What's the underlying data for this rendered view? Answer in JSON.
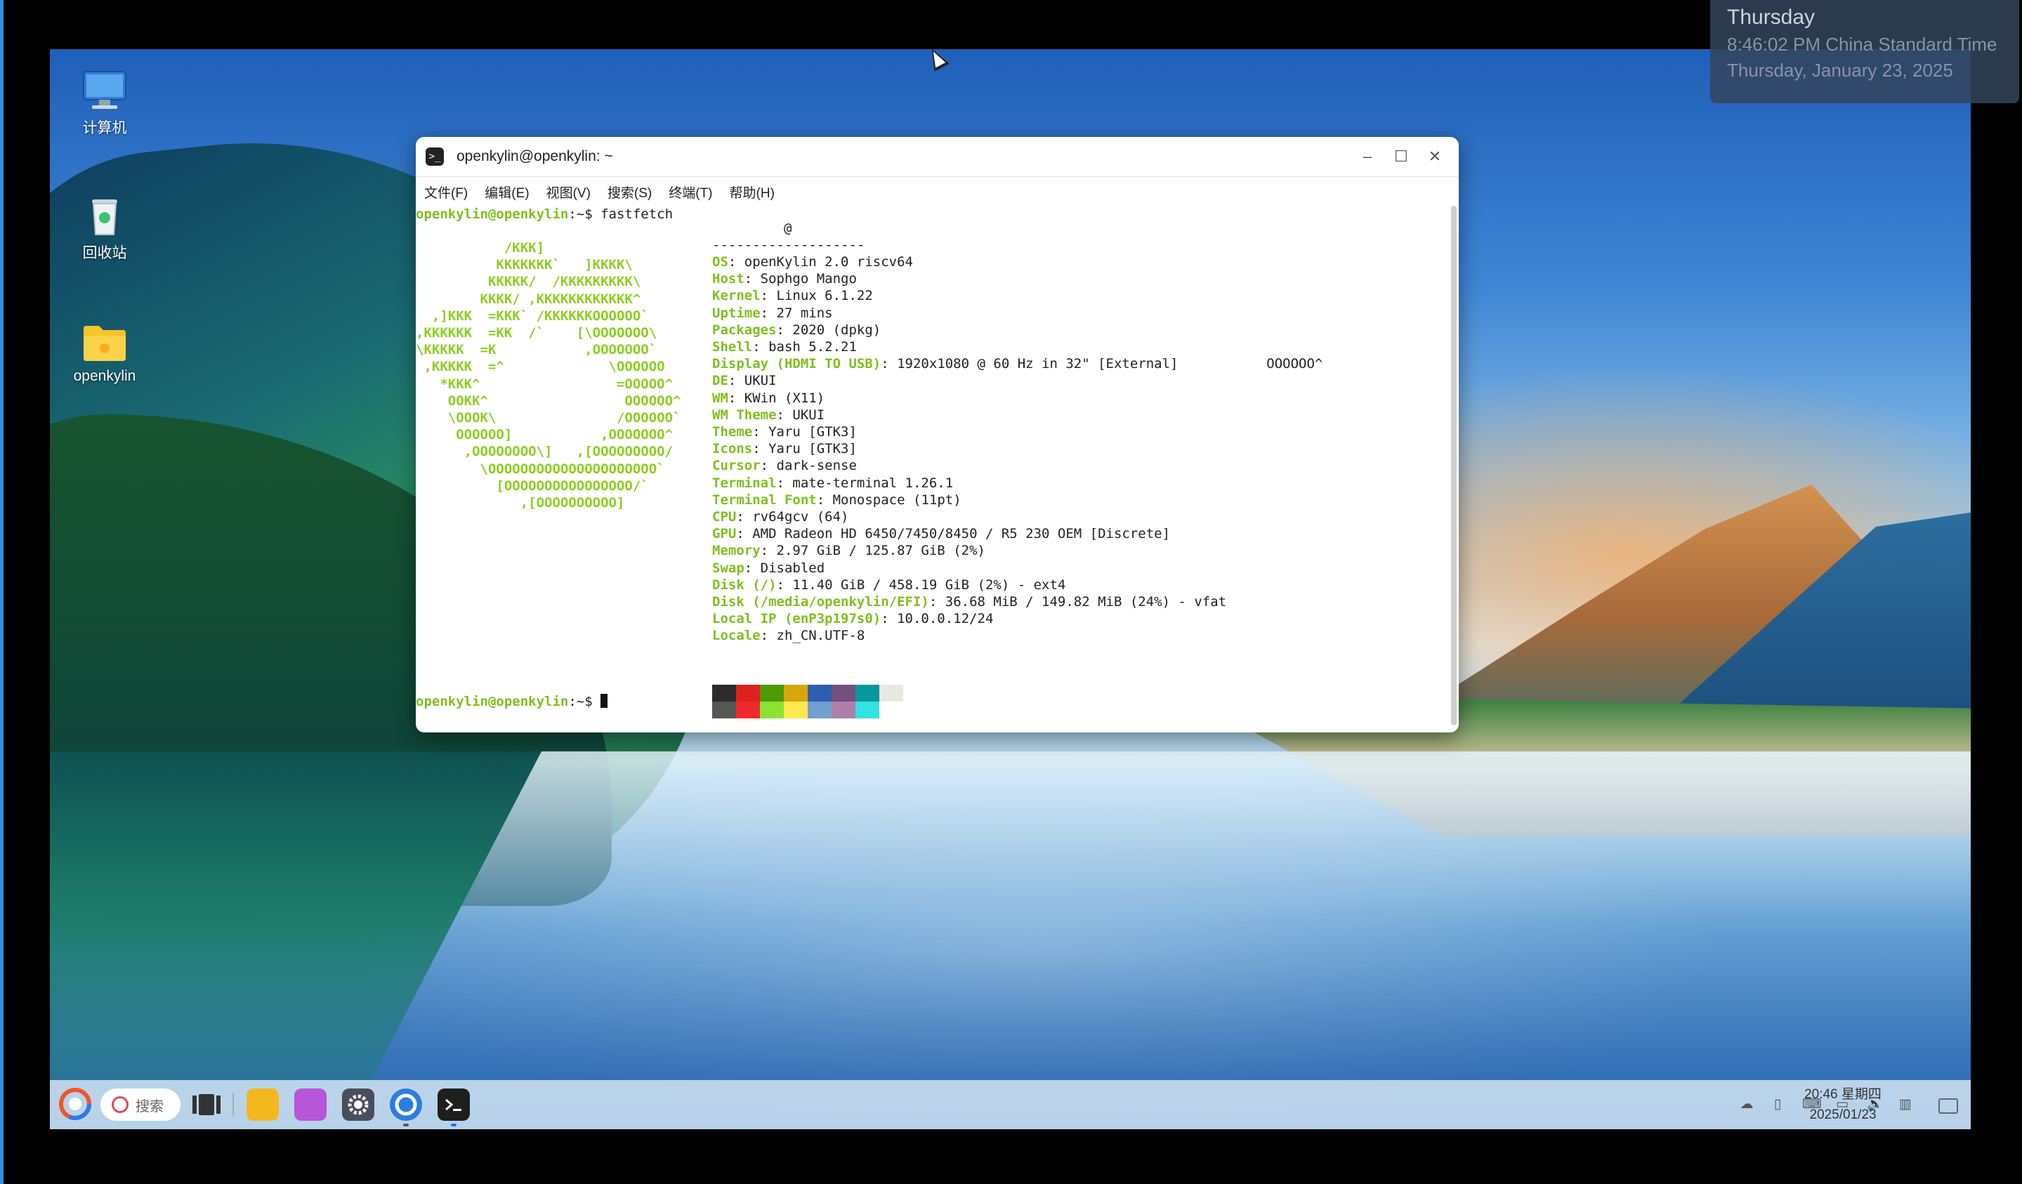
{
  "desktop": {
    "icons": [
      {
        "label": "计算机",
        "icon": "computer-icon"
      },
      {
        "label": "回收站",
        "icon": "trash-icon"
      },
      {
        "label": "openkylin",
        "icon": "folder-icon"
      }
    ]
  },
  "terminal": {
    "title": "openkylin@openkylin: ~",
    "menu": [
      "文件(F)",
      "编辑(E)",
      "视图(V)",
      "搜索(S)",
      "终端(T)",
      "帮助(H)"
    ],
    "prompt_user": "openkylin@openkylin",
    "prompt_suffix": ":~$ ",
    "command": "fastfetch",
    "header": "@",
    "separator": "-------------------",
    "logo": "           /KKK]\n          KKKKKKK`   ]KKKK\\\n         KKKKK/  /KKKKKKKKK\\\n        KKKK/ ,KKKKKKKKKKKK^\n  ,]KKK  =KKK` /KKKKKKOOOOOO`\n,KKKKKK  =KK  /`    [\\OOOOOOO\\\n\\KKKKK  =K           ,OOOOOOO`\n ,KKKKK  =^             \\OOOOOO\n   *KKK^                 =OOOOO^\n    OOKK^                 OOOOOO^\n    \\OOOK\\               /OOOOOO`\n     OOOOOO]           ,OOOOOOO^\n      ,OOOOOOOO\\]   ,[OOOOOOOOO/\n        \\OOOOOOOOOOOOOOOOOOOOO`\n          [OOOOOOOOOOOOOOOO/`\n             ,[OOOOOOOOOO]",
    "info": [
      {
        "key": "OS",
        "value": "openKylin 2.0 riscv64"
      },
      {
        "key": "Host",
        "value": "Sophgo Mango"
      },
      {
        "key": "Kernel",
        "value": "Linux 6.1.22"
      },
      {
        "key": "Uptime",
        "value": "27 mins"
      },
      {
        "key": "Packages",
        "value": "2020 (dpkg)"
      },
      {
        "key": "Shell",
        "value": "bash 5.2.21"
      },
      {
        "key": "Display (HDMI TO USB)",
        "value": "1920x1080 @ 60 Hz in 32\" [External]           OOOOOO^"
      },
      {
        "key": "DE",
        "value": "UKUI"
      },
      {
        "key": "WM",
        "value": "KWin (X11)"
      },
      {
        "key": "WM Theme",
        "value": "UKUI"
      },
      {
        "key": "Theme",
        "value": "Yaru [GTK3]"
      },
      {
        "key": "Icons",
        "value": "Yaru [GTK3]"
      },
      {
        "key": "Cursor",
        "value": "dark-sense"
      },
      {
        "key": "Terminal",
        "value": "mate-terminal 1.26.1"
      },
      {
        "key": "Terminal Font",
        "value": "Monospace (11pt)"
      },
      {
        "key": "CPU",
        "value": "rv64gcv (64)"
      },
      {
        "key": "GPU",
        "value": "AMD Radeon HD 6450/7450/8450 / R5 230 OEM [Discrete]"
      },
      {
        "key": "Memory",
        "value": "2.97 GiB / 125.87 GiB (2%)"
      },
      {
        "key": "Swap",
        "value": "Disabled"
      },
      {
        "key": "Disk (/)",
        "value": "11.40 GiB / 458.19 GiB (2%) - ext4"
      },
      {
        "key": "Disk (/media/openkylin/EFI)",
        "value": "36.68 MiB / 149.82 MiB (24%) - vfat"
      },
      {
        "key": "Local IP (enP3p197s0)",
        "value": "10.0.0.12/24"
      },
      {
        "key": "Locale",
        "value": "zh_CN.UTF-8"
      }
    ],
    "palette_top": [
      "#2b2b2b",
      "#e0201c",
      "#4e9a06",
      "#d9a50c",
      "#2e5eb0",
      "#75507b",
      "#06989a",
      "#e8e8e0"
    ],
    "palette_bottom": [
      "#555753",
      "#ef2929",
      "#8ae234",
      "#fce94f",
      "#729fcf",
      "#ad7fa8",
      "#34e2e2"
    ]
  },
  "taskbar": {
    "search_placeholder": "搜索",
    "apps": [
      "start-menu-icon",
      "multitask-view-icon",
      "file-manager-icon",
      "app-store-icon",
      "settings-icon",
      "browser-icon",
      "terminal-icon"
    ],
    "clock_time": "20:46 星期四",
    "clock_date": "2025/01/23"
  },
  "tooltip": {
    "day": "Thursday",
    "time": "8:46:02 PM China Standard Time",
    "date": "Thursday, January 23, 2025"
  }
}
